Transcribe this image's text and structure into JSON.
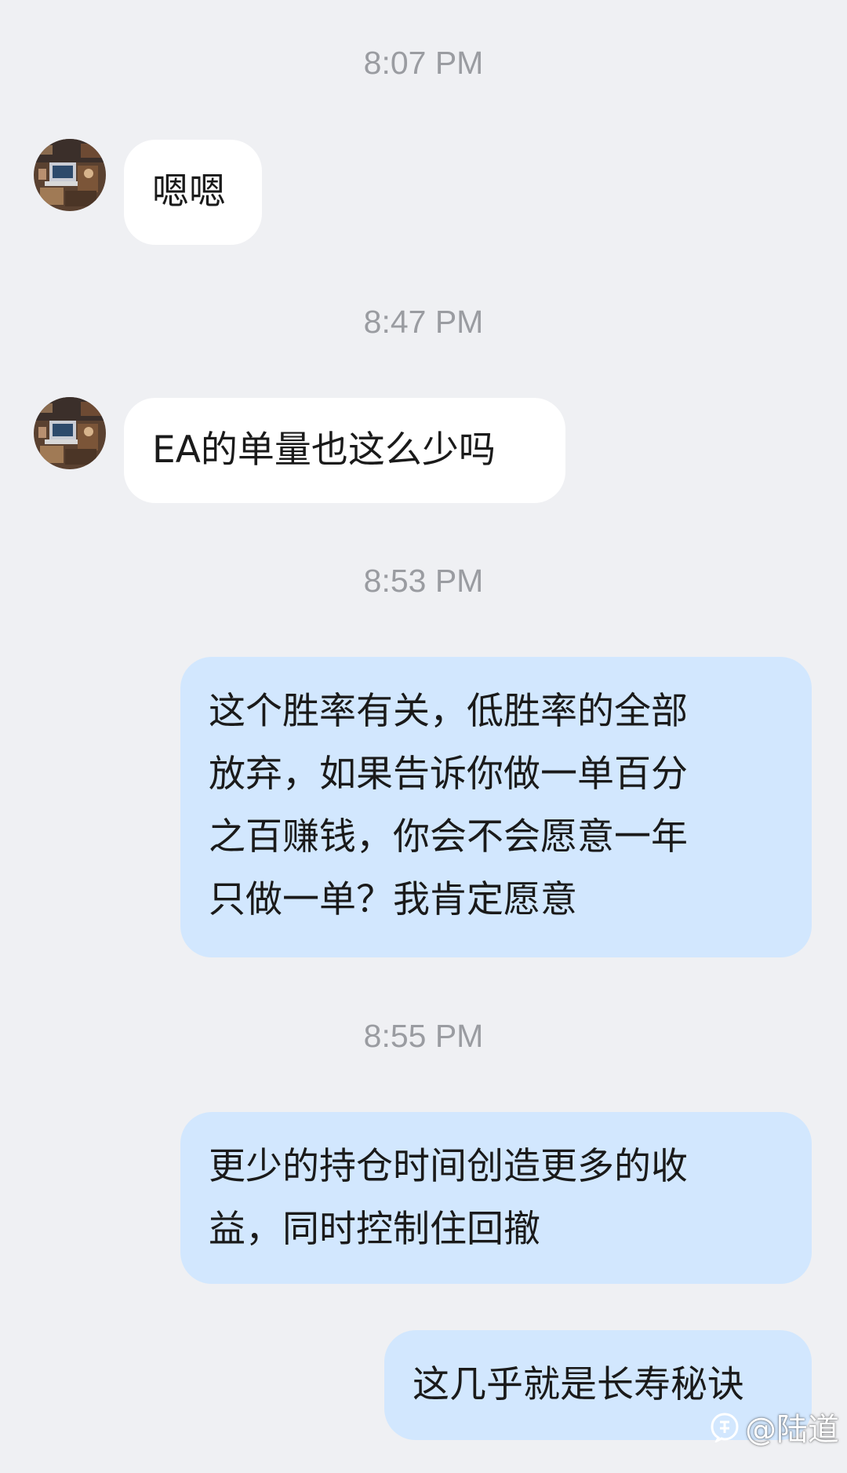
{
  "messages": [
    {
      "time": "8:07 PM",
      "text": "嗯嗯"
    },
    {
      "time": "8:47 PM",
      "text": "EA的单量也这么少吗"
    },
    {
      "time": "8:53 PM",
      "lines": [
        "这个胜率有关，低胜率的全部",
        "放弃，如果告诉你做一单百分",
        "之百赚钱，你会不会愿意一年",
        "只做一单？我肯定愿意"
      ]
    },
    {
      "time": "8:55 PM",
      "lines": [
        "更少的持仓时间创造更多的收",
        "益，同时控制住回撤"
      ]
    },
    {
      "text": "这几乎就是长寿秘诀"
    }
  ],
  "watermark": {
    "text": "@陆道",
    "icon": "zhihu-logo-icon"
  },
  "colors": {
    "background": "#eff0f3",
    "incoming_bubble": "#ffffff",
    "outgoing_bubble": "#d2e7fe",
    "timestamp": "#9a9ca1",
    "text": "#1a1a1a"
  }
}
